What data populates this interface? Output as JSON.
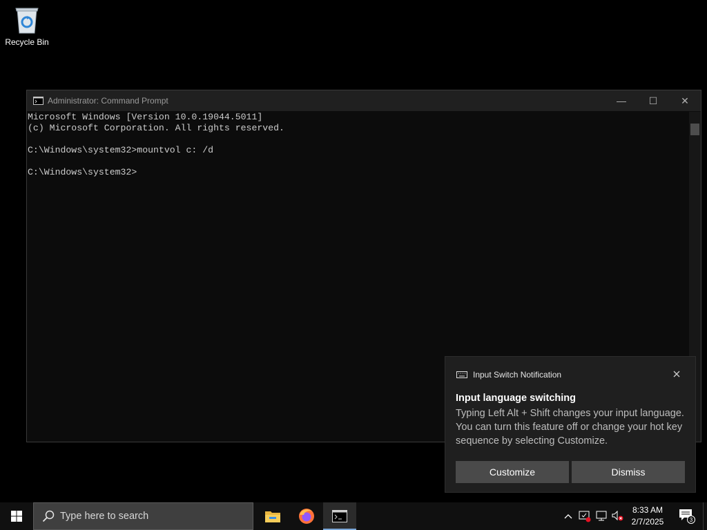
{
  "desktop": {
    "recycle_bin_label": "Recycle Bin"
  },
  "cmd": {
    "title": "Administrator: Command Prompt",
    "controls": {
      "minimize": "—",
      "maximize": "☐",
      "close": "✕"
    },
    "lines": [
      "Microsoft Windows [Version 10.0.19044.5011]",
      "(c) Microsoft Corporation. All rights reserved.",
      "",
      "C:\\Windows\\system32>mountvol c: /d",
      "",
      "C:\\Windows\\system32>"
    ]
  },
  "notification": {
    "app_name": "Input Switch Notification",
    "title": "Input language switching",
    "body": "Typing Left Alt + Shift changes your input language. You can turn this feature off or change your hot key sequence by selecting Customize.",
    "customize_label": "Customize",
    "dismiss_label": "Dismiss"
  },
  "taskbar": {
    "search_placeholder": "Type here to search",
    "apps": [
      "file-explorer-icon",
      "firefox-icon",
      "command-prompt-icon"
    ],
    "clock_time": "8:33 AM",
    "clock_date": "2/7/2025",
    "notification_count": "3",
    "accent_color": "#7aa7d8"
  }
}
